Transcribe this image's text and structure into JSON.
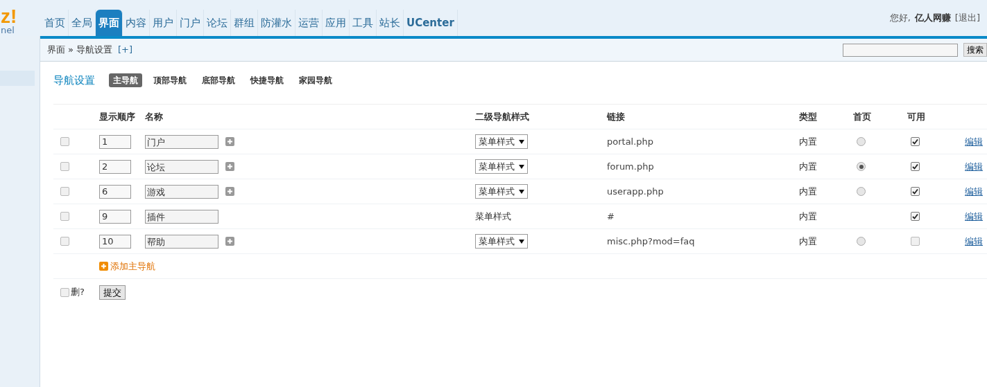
{
  "logo": {
    "mark": "z!",
    "subtitle": "nel"
  },
  "top_nav": [
    {
      "label": "首页",
      "selected": false
    },
    {
      "label": "全局",
      "selected": false
    },
    {
      "label": "界面",
      "selected": true
    },
    {
      "label": "内容",
      "selected": false
    },
    {
      "label": "用户",
      "selected": false
    },
    {
      "label": "门户",
      "selected": false
    },
    {
      "label": "论坛",
      "selected": false
    },
    {
      "label": "群组",
      "selected": false
    },
    {
      "label": "防灌水",
      "selected": false
    },
    {
      "label": "运营",
      "selected": false
    },
    {
      "label": "应用",
      "selected": false
    },
    {
      "label": "工具",
      "selected": false
    },
    {
      "label": "站长",
      "selected": false
    },
    {
      "label": "UCenter",
      "selected": false
    }
  ],
  "user": {
    "greeting": "您好,",
    "name": "亿人网赚",
    "logout": "[退出]"
  },
  "breadcrumb": {
    "parent": "界面",
    "separator": "»",
    "current": "导航设置",
    "add": "[+]"
  },
  "search": {
    "button": "搜索"
  },
  "page_title": "导航设置",
  "sub_tabs": [
    {
      "label": "主导航",
      "selected": true
    },
    {
      "label": "顶部导航",
      "selected": false
    },
    {
      "label": "底部导航",
      "selected": false
    },
    {
      "label": "快捷导航",
      "selected": false
    },
    {
      "label": "家园导航",
      "selected": false
    }
  ],
  "table": {
    "columns": [
      "显示顺序",
      "名称",
      "二级导航样式",
      "链接",
      "类型",
      "首页",
      "可用"
    ],
    "rows": [
      {
        "checked": false,
        "order": "1",
        "name": "门户",
        "addable": true,
        "kind": "select",
        "style": "菜单样式",
        "link": "portal.php",
        "type": "内置",
        "home": {
          "selected": false
        },
        "enabled": true,
        "edit": "编辑"
      },
      {
        "checked": false,
        "order": "2",
        "name": "论坛",
        "addable": true,
        "kind": "select",
        "style": "菜单样式",
        "link": "forum.php",
        "type": "内置",
        "home": {
          "selected": true
        },
        "enabled": true,
        "edit": "编辑"
      },
      {
        "checked": false,
        "order": "6",
        "name": "游戏",
        "addable": true,
        "kind": "select",
        "style": "菜单样式",
        "link": "userapp.php",
        "type": "内置",
        "home": {
          "selected": false
        },
        "enabled": true,
        "edit": "编辑"
      },
      {
        "checked": false,
        "order": "9",
        "name": "插件",
        "addable": false,
        "kind": "text",
        "style": "菜单样式",
        "link": "#",
        "type": "内置",
        "enabled": true,
        "edit": "编辑"
      },
      {
        "checked": false,
        "order": "10",
        "name": "帮助",
        "addable": true,
        "kind": "select",
        "style": "菜单样式",
        "link": "misc.php?mod=faq",
        "type": "内置",
        "home": {
          "selected": false
        },
        "enabled": false,
        "edit": "编辑"
      }
    ],
    "add_link": "添加主导航"
  },
  "footer": {
    "delete_checked": false,
    "delete_label": "删?",
    "submit": "提交"
  }
}
